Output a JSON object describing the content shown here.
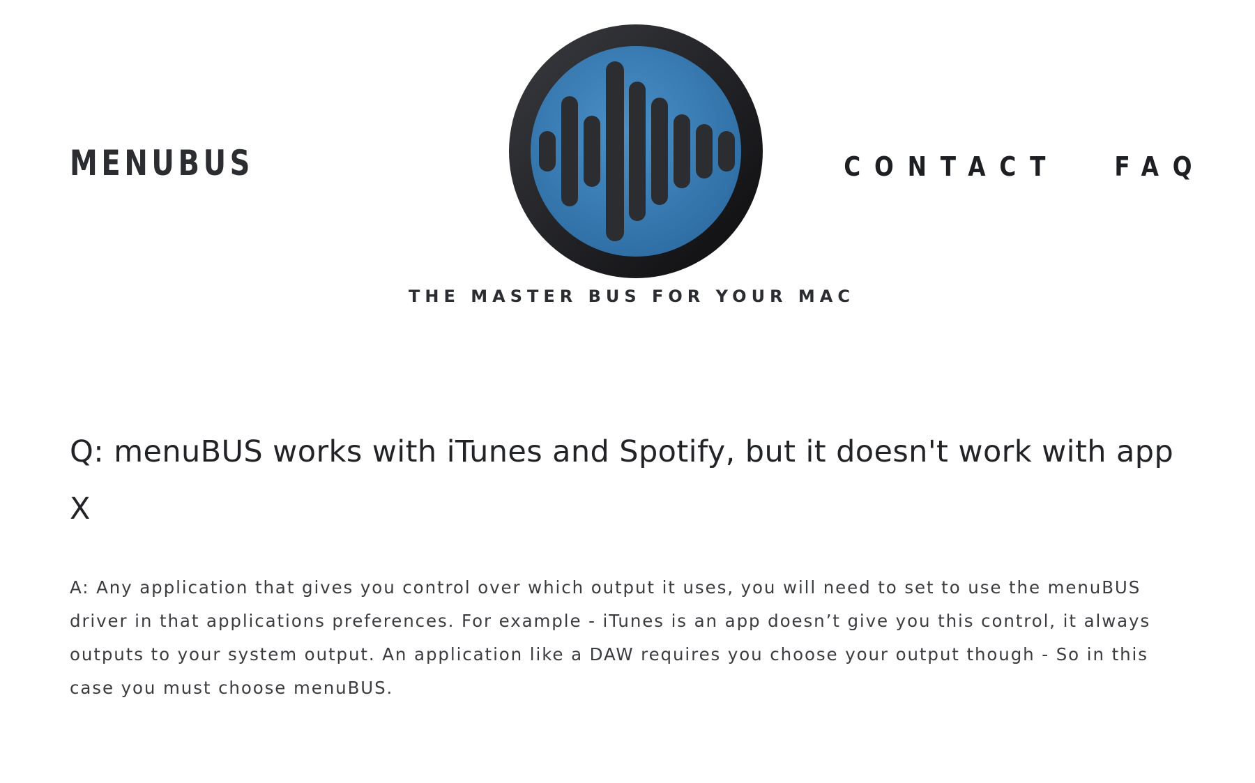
{
  "header": {
    "site_title": "MENUBUS",
    "tagline": "THE MASTER BUS FOR YOUR MAC",
    "nav": [
      {
        "label": "CONTACT"
      },
      {
        "label": "FAQ"
      }
    ]
  },
  "logo": {
    "icon": "sound-wave-icon",
    "ring_color": "#1b1c1f",
    "disc_color": "#3a7db3",
    "bar_color": "#2b2d31"
  },
  "faq": {
    "question": "Q: menuBUS works with iTunes and Spotify, but it doesn't work with app X",
    "answer": "A: Any application that gives you control over which output it uses, you will need to set to use the menuBUS driver in that applications preferences. For example - iTunes is an app doesn’t give you this control, it always outputs to your system output. An application like a DAW requires you choose your output though - So in this case you must choose menuBUS."
  }
}
